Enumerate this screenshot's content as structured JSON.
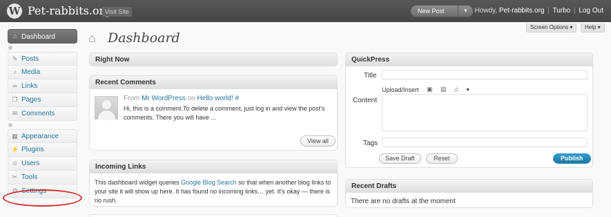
{
  "header": {
    "logo_letter": "W",
    "site_title": "Pet-rabbits.org",
    "visit_site": "Visit Site",
    "new_post": "New Post",
    "greeting_prefix": "Howdy,",
    "username": "Pet-rabbits.org",
    "turbo": "Turbo",
    "logout": "Log Out"
  },
  "sidebar": {
    "dashboard": "Dashboard",
    "items_group1": [
      {
        "label": "Posts",
        "icon": "pin-icon"
      },
      {
        "label": "Media",
        "icon": "media-icon"
      },
      {
        "label": "Links",
        "icon": "links-icon"
      },
      {
        "label": "Pages",
        "icon": "pages-icon"
      },
      {
        "label": "Comments",
        "icon": "comments-icon"
      }
    ],
    "items_group2": [
      {
        "label": "Appearance",
        "icon": "appearance-icon"
      },
      {
        "label": "Plugins",
        "icon": "plugins-icon"
      },
      {
        "label": "Users",
        "icon": "users-icon"
      },
      {
        "label": "Tools",
        "icon": "tools-icon"
      },
      {
        "label": "Settings",
        "icon": "settings-icon"
      }
    ],
    "highlight_color": "#d62d2d"
  },
  "main": {
    "page_title": "Dashboard",
    "screen_options": "Screen Options ▾",
    "help": "Help ▾"
  },
  "right_now": {
    "title": "Right Now"
  },
  "recent_comments": {
    "title": "Recent Comments",
    "from": "From",
    "author": "Mr WordPress",
    "on": "on",
    "post": "Hello world! #",
    "excerpt": "Hi, this is a comment.To delete a comment, just log in and view the post's comments. There you will have ...",
    "view_all": "View all"
  },
  "incoming_links": {
    "title": "Incoming Links",
    "text_before": "This dashboard widget queries",
    "link": "Google Blog Search",
    "text_after": "so that when another blog links to your site it will show up here. It has found no incoming links… yet. It's okay — there is no rush."
  },
  "quickpress": {
    "title": "QuickPress",
    "title_label": "Title",
    "upload_insert": "Upload/Insert",
    "content_label": "Content",
    "tags_label": "Tags",
    "save_draft": "Save Draft",
    "reset": "Reset",
    "publish": "Publish"
  },
  "recent_drafts": {
    "title": "Recent Drafts",
    "empty_text": "There are no drafts at the moment"
  }
}
